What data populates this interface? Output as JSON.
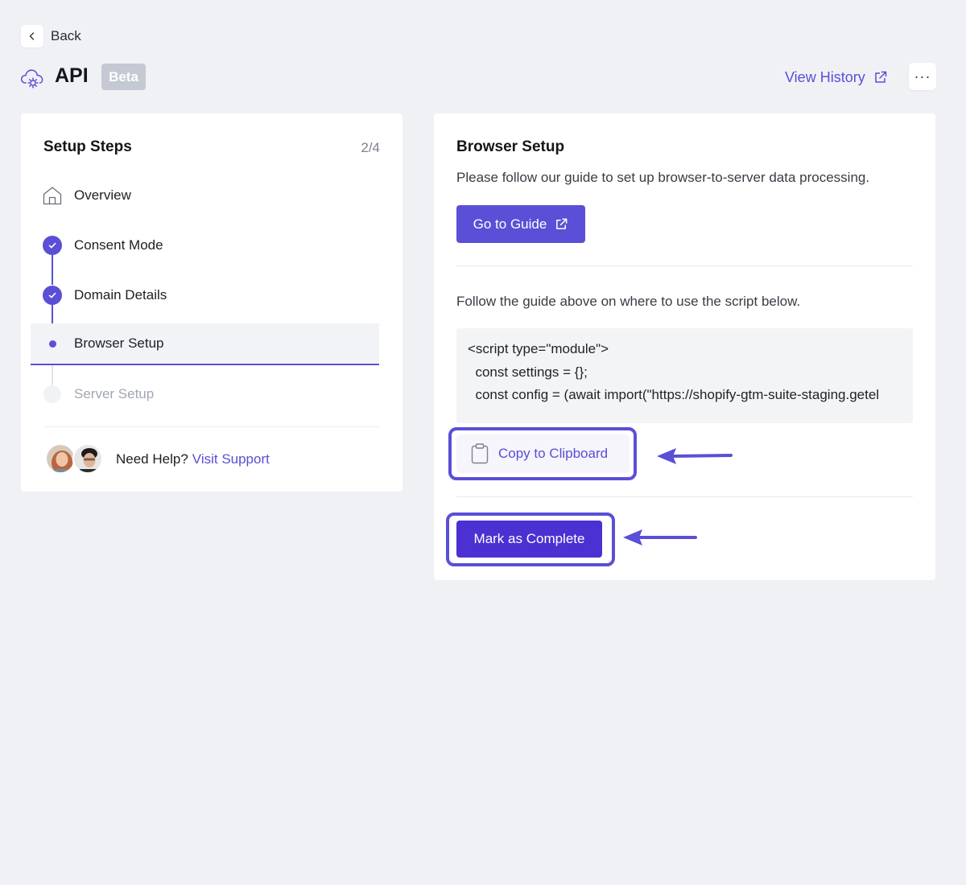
{
  "nav": {
    "back_label": "Back"
  },
  "header": {
    "title": "API",
    "badge": "Beta",
    "view_history": "View History",
    "more": "···"
  },
  "setup_steps": {
    "title": "Setup Steps",
    "count": "2/4",
    "items": [
      {
        "label": "Overview",
        "state": "overview"
      },
      {
        "label": "Consent Mode",
        "state": "completed"
      },
      {
        "label": "Domain Details",
        "state": "completed"
      },
      {
        "label": "Browser Setup",
        "state": "active"
      },
      {
        "label": "Server Setup",
        "state": "disabled"
      }
    ]
  },
  "help": {
    "text": "Need Help?",
    "link": "Visit Support"
  },
  "browser_setup": {
    "title": "Browser Setup",
    "description": "Please follow our guide to set up browser-to-server data processing.",
    "guide_button": "Go to Guide",
    "follow_text": "Follow the guide above on where to use the script below.",
    "code": "<script type=\"module\">\n  const settings = {};\n  const config = (await import(\"https://shopify-gtm-suite-staging.getel",
    "copy_button": "Copy to Clipboard",
    "complete_button": "Mark as Complete"
  },
  "colors": {
    "accent": "#5a4fd6",
    "complete_button": "#4b30d2",
    "background": "#eff1f5",
    "badge": "#c4c9d4"
  }
}
